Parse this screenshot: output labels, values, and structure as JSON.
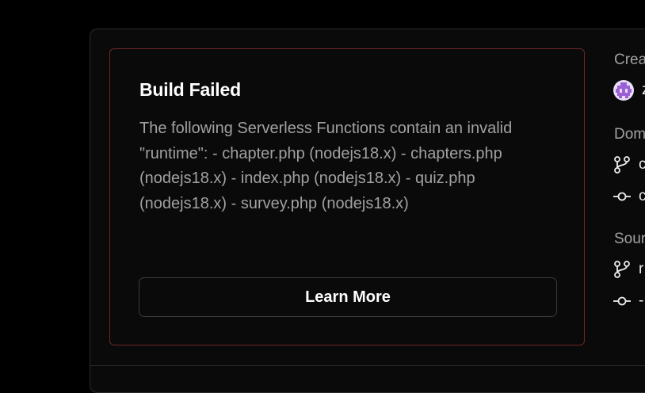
{
  "error": {
    "title": "Build Failed",
    "message": "The following Serverless Functions contain an invalid \"runtime\": - chapter.php (nodejs18.x) - chapters.php (nodejs18.x) - index.php (nodejs18.x) - quiz.php (nodejs18.x) - survey.php (nodejs18.x)",
    "button_label": "Learn More",
    "border_color": "#6e2527"
  },
  "sidebar": {
    "created_label": "Crea",
    "creator_initial": "z",
    "domains_label": "Dom",
    "domain_rows": [
      {
        "icon": "git-branch-icon",
        "text": "c"
      },
      {
        "icon": "git-commit-icon",
        "text": "c"
      }
    ],
    "source_label": "Sour",
    "source_rows": [
      {
        "icon": "git-branch-icon",
        "text": "r"
      },
      {
        "icon": "git-commit-icon",
        "text": "-"
      }
    ]
  }
}
